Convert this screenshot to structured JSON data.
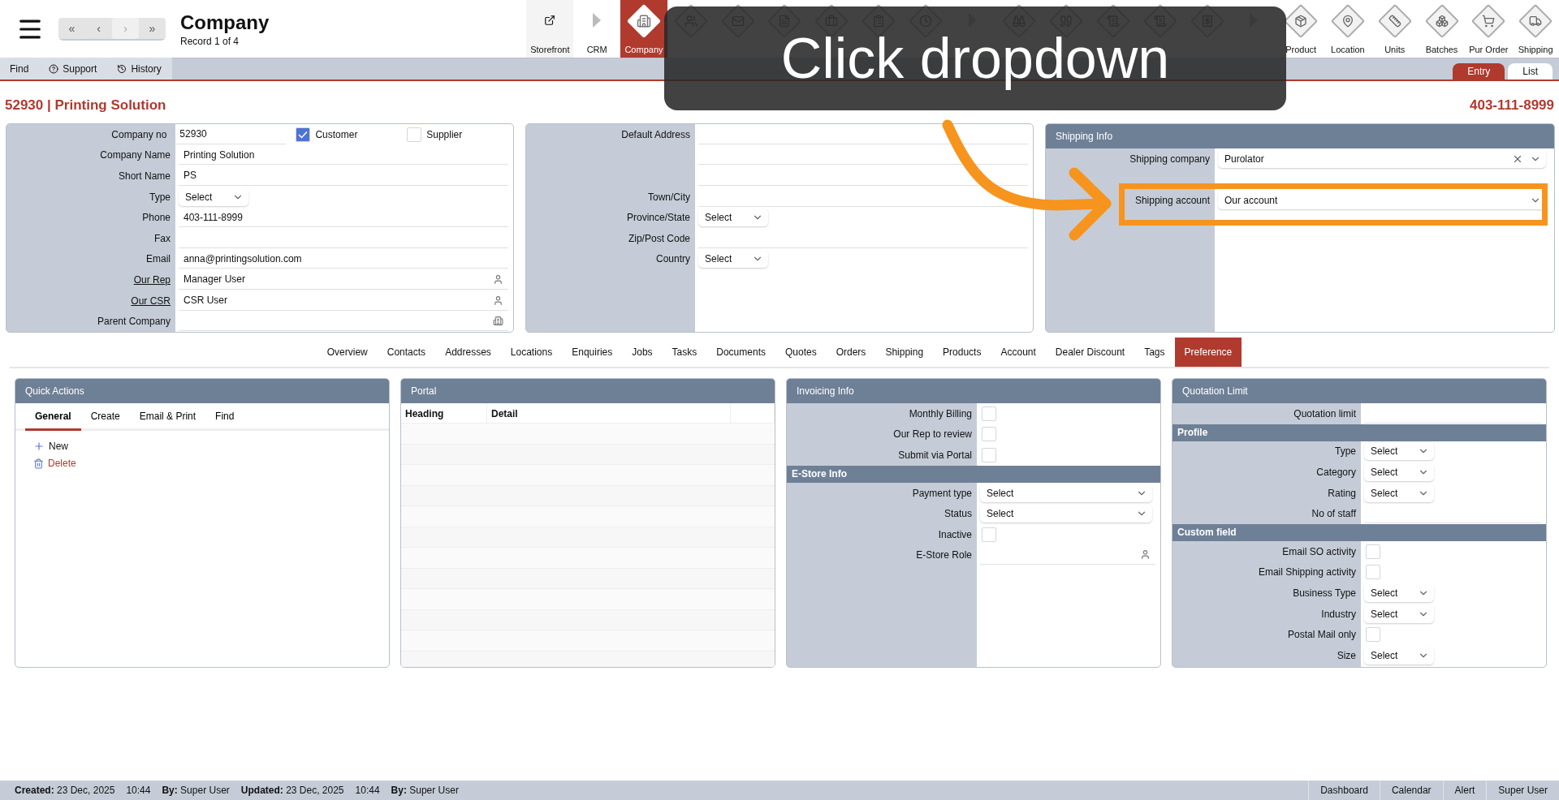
{
  "header": {
    "title": "Company",
    "subtitle": "Record 1 of 4",
    "nav": [
      {
        "label": "«",
        "disabled": false
      },
      {
        "label": "‹",
        "disabled": false
      },
      {
        "label": "›",
        "disabled": true
      },
      {
        "label": "»",
        "disabled": false
      }
    ]
  },
  "toolbar": [
    {
      "kind": "link",
      "label": "Storefront",
      "selected": false
    },
    {
      "kind": "arrow",
      "label": "CRM",
      "selected": false
    },
    {
      "kind": "tile",
      "label": "Company",
      "selected": true
    },
    {
      "kind": "tile",
      "selected": false
    },
    {
      "kind": "tile",
      "selected": false
    },
    {
      "kind": "tile",
      "selected": false
    },
    {
      "kind": "tile",
      "selected": false
    },
    {
      "kind": "tile",
      "selected": false
    },
    {
      "kind": "tile",
      "selected": false
    },
    {
      "kind": "arrow",
      "selected": false
    },
    {
      "kind": "tile",
      "selected": false
    },
    {
      "kind": "tile",
      "selected": false
    },
    {
      "kind": "tile",
      "selected": false
    },
    {
      "kind": "tile",
      "selected": false
    },
    {
      "kind": "tile",
      "selected": false
    },
    {
      "kind": "arrow",
      "selected": false
    },
    {
      "kind": "tile",
      "label": "Product",
      "selected": false
    },
    {
      "kind": "tile",
      "label": "Location",
      "selected": false
    },
    {
      "kind": "tile",
      "label": "Units",
      "selected": false
    },
    {
      "kind": "tile",
      "label": "Batches",
      "selected": false
    },
    {
      "kind": "tile",
      "label": "Pur Order",
      "selected": false
    },
    {
      "kind": "tile",
      "label": "Shipping",
      "selected": false
    }
  ],
  "subbar": {
    "actions": [
      "Find",
      "Support",
      "History"
    ],
    "views": [
      {
        "label": "Entry",
        "selected": true
      },
      {
        "label": "List",
        "selected": false
      }
    ]
  },
  "record": {
    "title": "52930 | Printing Solution",
    "phone": "403-111-8999"
  },
  "company_panel": {
    "rows": [
      {
        "kind": "text",
        "label": "Company no",
        "value": "52930"
      },
      {
        "kind": "text",
        "label": "Company Name",
        "value": "Printing Solution"
      },
      {
        "kind": "text",
        "label": "Short Name",
        "value": "PS"
      },
      {
        "kind": "select",
        "label": "Type",
        "value": "Select"
      },
      {
        "kind": "text",
        "label": "Phone",
        "value": "403-111-8999"
      },
      {
        "kind": "text",
        "label": "Fax"
      },
      {
        "kind": "text",
        "label": "Email",
        "value": "anna@printingsolution.com"
      },
      {
        "kind": "person",
        "label": "Our Rep",
        "value": "Manager User",
        "link": true
      },
      {
        "kind": "person",
        "label": "Our CSR",
        "value": "CSR User",
        "link": true
      },
      {
        "kind": "building",
        "label": "Parent Company"
      }
    ],
    "flags": [
      {
        "label": "Customer",
        "checked": true
      },
      {
        "label": "Supplier",
        "checked": false
      }
    ]
  },
  "address_panel": {
    "rows": [
      {
        "kind": "text",
        "label": "Default Address"
      },
      {
        "kind": "text"
      },
      {
        "kind": "text"
      },
      {
        "kind": "text",
        "label": "Town/City"
      },
      {
        "kind": "select",
        "label": "Province/State",
        "value": "Select"
      },
      {
        "kind": "text",
        "label": "Zip/Post Code"
      },
      {
        "kind": "select",
        "label": "Country",
        "value": "Select"
      }
    ]
  },
  "shipping_panel": {
    "title": "Shipping Info",
    "rows": [
      {
        "kind": "combo",
        "label": "Shipping company",
        "value": "Purolator"
      },
      {
        "kind": "blank"
      },
      {
        "kind": "wide",
        "label": "Shipping account",
        "value": "Our account"
      },
      {
        "kind": "blank"
      }
    ]
  },
  "tabs": [
    {
      "label": "Overview",
      "selected": false
    },
    {
      "label": "Contacts",
      "selected": false
    },
    {
      "label": "Addresses",
      "selected": false
    },
    {
      "label": "Locations",
      "selected": false
    },
    {
      "label": "Enquiries",
      "selected": false
    },
    {
      "label": "Jobs",
      "selected": false
    },
    {
      "label": "Tasks",
      "selected": false
    },
    {
      "label": "Documents",
      "selected": false
    },
    {
      "label": "Quotes",
      "selected": false
    },
    {
      "label": "Orders",
      "selected": false
    },
    {
      "label": "Shipping",
      "selected": false
    },
    {
      "label": "Products",
      "selected": false
    },
    {
      "label": "Account",
      "selected": false
    },
    {
      "label": "Dealer Discount",
      "selected": false
    },
    {
      "label": "Tags",
      "selected": false
    },
    {
      "label": "Preference",
      "selected": true
    }
  ],
  "quick_actions": {
    "title": "Quick Actions",
    "tabs": [
      {
        "label": "General",
        "selected": true
      },
      {
        "label": "Create",
        "selected": false
      },
      {
        "label": "Email & Print",
        "selected": false
      },
      {
        "label": "Find",
        "selected": false
      }
    ],
    "actions": [
      {
        "kind": "add",
        "label": "New"
      },
      {
        "kind": "delete",
        "label": "Delete"
      }
    ]
  },
  "portal": {
    "title": "Portal",
    "columns": [
      "Heading",
      "Detail"
    ]
  },
  "invoicing": {
    "title": "Invoicing Info",
    "rows": [
      {
        "kind": "checkbox",
        "label": "Monthly Billing",
        "checked": false
      },
      {
        "kind": "checkbox",
        "label": "Our Rep to review",
        "checked": false
      },
      {
        "kind": "checkbox",
        "label": "Submit via Portal",
        "checked": false
      },
      {
        "kind": "section",
        "label": "E-Store Info"
      },
      {
        "kind": "wide",
        "label": "Payment type",
        "value": "Select"
      },
      {
        "kind": "wide",
        "label": "Status",
        "value": "Select"
      },
      {
        "kind": "checkbox",
        "label": "Inactive",
        "checked": false
      },
      {
        "kind": "person",
        "label": "E-Store Role"
      }
    ]
  },
  "quotation": {
    "title": "Quotation Limit",
    "rows": [
      {
        "kind": "text",
        "label": "Quotation limit"
      },
      {
        "kind": "section",
        "label": "Profile"
      },
      {
        "kind": "select",
        "label": "Type",
        "value": "Select"
      },
      {
        "kind": "select",
        "label": "Category",
        "value": "Select"
      },
      {
        "kind": "select",
        "label": "Rating",
        "value": "Select"
      },
      {
        "kind": "text",
        "label": "No of staff"
      },
      {
        "kind": "section",
        "label": "Custom field"
      },
      {
        "kind": "checkbox",
        "label": "Email SO activity",
        "checked": false
      },
      {
        "kind": "checkbox",
        "label": "Email Shipping activity",
        "checked": false
      },
      {
        "kind": "select",
        "label": "Business Type",
        "value": "Select"
      },
      {
        "kind": "select",
        "label": "Industry",
        "value": "Select"
      },
      {
        "kind": "checkbox",
        "label": "Postal Mail only",
        "checked": false
      },
      {
        "kind": "select",
        "label": "Size",
        "value": "Select"
      }
    ]
  },
  "footer": {
    "info": [
      "**Created:** 23 Dec, 2025",
      "10:44",
      "**By:** Super User",
      "**Updated:** 23 Dec, 2025",
      "10:44",
      "**By:** Super User"
    ],
    "links": [
      "Dashboard",
      "Calendar",
      "Alert",
      "Super User"
    ]
  },
  "tutorial": {
    "message": "Click dropdown"
  }
}
